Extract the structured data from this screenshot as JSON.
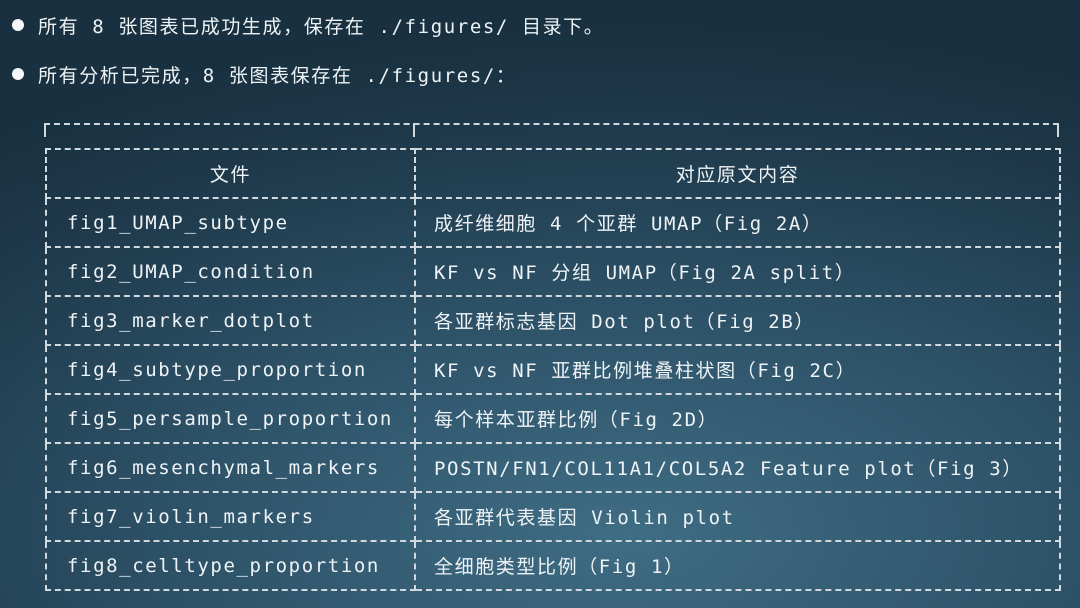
{
  "lines": [
    "所有 8 张图表已成功生成，保存在 ./figures/ 目录下。",
    "所有分析已完成，8 张图表保存在 ./figures/："
  ],
  "table": {
    "headers": [
      "文件",
      "对应原文内容"
    ],
    "rows": [
      [
        "fig1_UMAP_subtype",
        "成纤维细胞 4 个亚群 UMAP（Fig 2A）"
      ],
      [
        "fig2_UMAP_condition",
        "KF vs NF 分组 UMAP（Fig 2A split）"
      ],
      [
        "fig3_marker_dotplot",
        "各亚群标志基因 Dot plot（Fig 2B）"
      ],
      [
        "fig4_subtype_proportion",
        "KF vs NF 亚群比例堆叠柱状图（Fig 2C）"
      ],
      [
        "fig5_persample_proportion",
        "每个样本亚群比例（Fig 2D）"
      ],
      [
        "fig6_mesenchymal_markers",
        "POSTN/FN1/COL11A1/COL5A2 Feature plot（Fig 3）"
      ],
      [
        "fig7_violin_markers",
        "各亚群代表基因 Violin plot"
      ],
      [
        "fig8_celltype_proportion",
        "全细胞类型比例（Fig 1）"
      ]
    ]
  }
}
